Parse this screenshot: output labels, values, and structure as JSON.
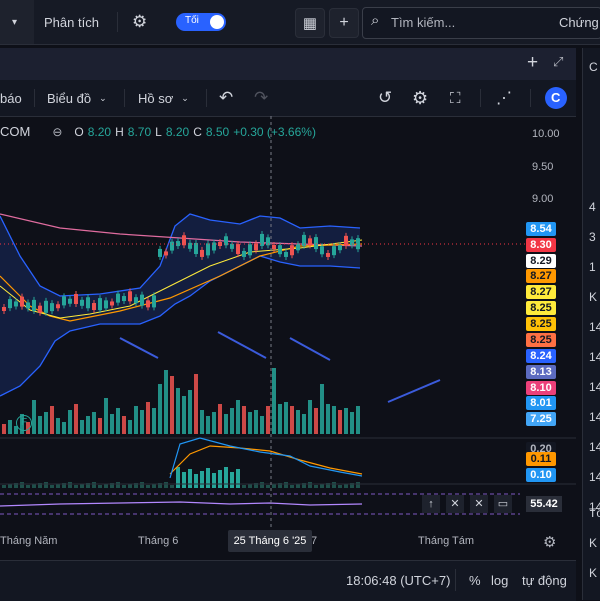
{
  "topbar": {
    "analysis_label": "Phân tích",
    "theme_toggle_label": "Tối",
    "search_placeholder": "Tìm kiếm...",
    "right_cut_label": "Chứng"
  },
  "chart_toolbar": {
    "report_label": "báo",
    "chart_label": "Biểu đồ",
    "profile_label": "Hồ sơ"
  },
  "legend": {
    "symbol": "COM",
    "open_label": "O",
    "open_value": "8.20",
    "high_label": "H",
    "high_value": "8.70",
    "low_label": "L",
    "low_value": "8.20",
    "close_label": "C",
    "close_value": "8.50",
    "change": "+0.30 (+3.66%)"
  },
  "price_axis": {
    "ticks": [
      "10.00",
      "9.50",
      "9.00"
    ],
    "boxes": [
      {
        "value": "8.54",
        "bg": "#2196f3",
        "fg": "#ffffff"
      },
      {
        "value": "8.30",
        "bg": "#f23645",
        "fg": "#ffffff"
      },
      {
        "value": "8.29",
        "bg": "#ffffff",
        "fg": "#131722"
      },
      {
        "value": "8.27",
        "bg": "#ff9800",
        "fg": "#131722"
      },
      {
        "value": "8.27",
        "bg": "#ffeb3b",
        "fg": "#131722"
      },
      {
        "value": "8.25",
        "bg": "#ffeb3b",
        "fg": "#131722"
      },
      {
        "value": "8.25",
        "bg": "#ffc107",
        "fg": "#131722"
      },
      {
        "value": "8.25",
        "bg": "#ff7043",
        "fg": "#131722"
      },
      {
        "value": "8.24",
        "bg": "#2962ff",
        "fg": "#ffffff"
      },
      {
        "value": "8.13",
        "bg": "#5c6bc0",
        "fg": "#ffffff"
      },
      {
        "value": "8.10",
        "bg": "#ec407a",
        "fg": "#ffffff"
      },
      {
        "value": "8.01",
        "bg": "#2196f3",
        "fg": "#ffffff"
      },
      {
        "value": "7.25",
        "bg": "#42a5f5",
        "fg": "#ffffff"
      }
    ],
    "indicator_boxes": [
      {
        "value": "0.20",
        "bg": "#131722",
        "fg": "#b2b5be"
      },
      {
        "value": "0.11",
        "bg": "#ff9800",
        "fg": "#131722"
      },
      {
        "value": "0.10",
        "bg": "#2196f3",
        "fg": "#ffffff"
      }
    ],
    "rsi_value": "55.42"
  },
  "time_axis": {
    "labels": [
      "Tháng Năm",
      "Tháng 6",
      "Tháng Tám"
    ],
    "crosshair_label": "25 Tháng 6 '25",
    "cut_label": "7"
  },
  "right_panel": {
    "labels": [
      "C",
      "4",
      "3",
      "1",
      "K",
      "14",
      "14",
      "14",
      "14",
      "14",
      "14",
      "14",
      "Tố",
      "K",
      "K"
    ]
  },
  "bottom": {
    "clock": "18:06:48 (UTC+7)",
    "percent_label": "%",
    "log_label": "log",
    "auto_label": "tự động"
  },
  "volume_marker": "F",
  "colors": {
    "up": "#26a69a",
    "down": "#ef5350",
    "bg": "#0e1018",
    "bollinger": "#2962ff",
    "accent": "#2962ff"
  }
}
